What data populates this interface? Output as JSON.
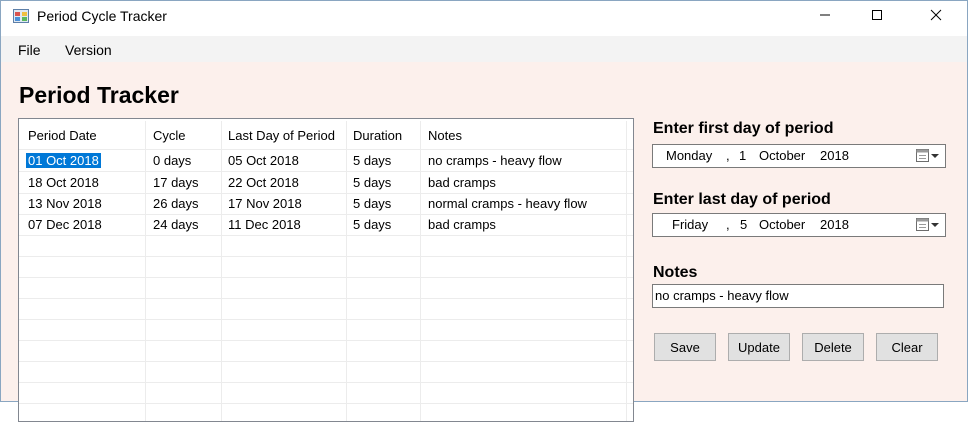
{
  "window": {
    "title": "Period Cycle Tracker"
  },
  "menu": {
    "items": [
      {
        "label": "File"
      },
      {
        "label": "Version"
      }
    ]
  },
  "main": {
    "heading": "Period Tracker",
    "table": {
      "columns": [
        "Period Date",
        "Cycle",
        "Last Day of Period",
        "Duration",
        "Notes"
      ],
      "rows": [
        {
          "date": "01 Oct 2018",
          "cycle": "0 days",
          "last_day": "05 Oct 2018",
          "duration": "5 days",
          "notes": "no cramps - heavy flow",
          "selected": true
        },
        {
          "date": "18 Oct 2018",
          "cycle": "17 days",
          "last_day": "22 Oct 2018",
          "duration": "5 days",
          "notes": "bad cramps"
        },
        {
          "date": "13 Nov 2018",
          "cycle": "26 days",
          "last_day": "17 Nov 2018",
          "duration": "5 days",
          "notes": "normal cramps - heavy flow"
        },
        {
          "date": "07 Dec 2018",
          "cycle": "24 days",
          "last_day": "11 Dec 2018",
          "duration": "5 days",
          "notes": "bad cramps"
        }
      ]
    }
  },
  "form": {
    "first_day": {
      "label": "Enter first day of period",
      "weekday": "Monday",
      "sep": ",",
      "day": "1",
      "month": "October",
      "year": "2018"
    },
    "last_day": {
      "label": "Enter last day of period",
      "weekday": "Friday",
      "sep": ",",
      "day": "5",
      "month": "October",
      "year": "2018"
    },
    "notes": {
      "label": "Notes",
      "value": "no cramps - heavy flow"
    },
    "buttons": {
      "save": "Save",
      "update": "Update",
      "delete": "Delete",
      "clear": "Clear"
    }
  },
  "colors": {
    "client_background": "#fcf0ec",
    "selection": "#0078d7"
  },
  "icons": [
    "app-icon",
    "minimize-icon",
    "maximize-icon",
    "close-icon",
    "calendar-dropdown-icon"
  ]
}
